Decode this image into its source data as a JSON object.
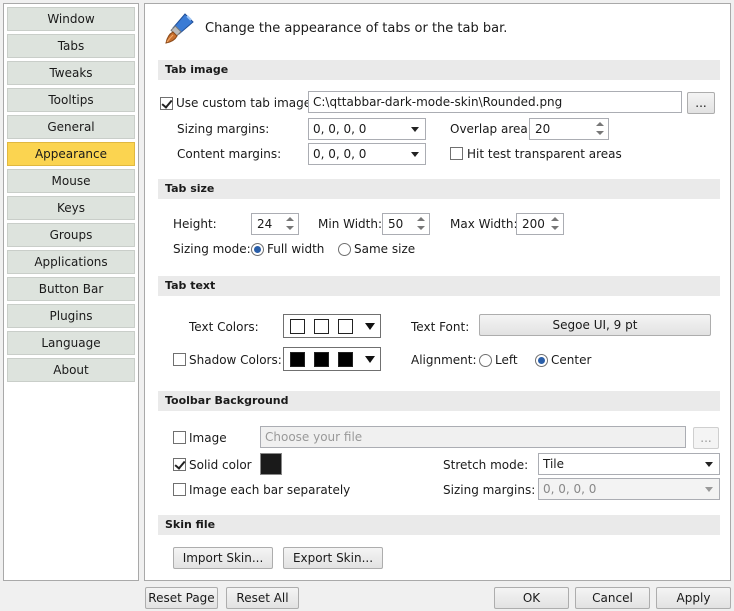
{
  "sidebar": {
    "items": [
      {
        "label": "Window"
      },
      {
        "label": "Tabs"
      },
      {
        "label": "Tweaks"
      },
      {
        "label": "Tooltips"
      },
      {
        "label": "General"
      },
      {
        "label": "Appearance",
        "active": true
      },
      {
        "label": "Mouse"
      },
      {
        "label": "Keys"
      },
      {
        "label": "Groups"
      },
      {
        "label": "Applications"
      },
      {
        "label": "Button Bar"
      },
      {
        "label": "Plugins"
      },
      {
        "label": "Language"
      },
      {
        "label": "About"
      }
    ]
  },
  "header": {
    "icon": "paintbrush-icon",
    "text": "Change the appearance of tabs or the tab bar."
  },
  "tab_image": {
    "section_title": "Tab image",
    "use_custom_label": "Use custom tab image:",
    "use_custom_checked": true,
    "path_value": "C:\\qttabbar-dark-mode-skin\\Rounded.png",
    "browse_label": "...",
    "sizing_margins_label": "Sizing margins:",
    "sizing_margins_value": "0, 0, 0, 0",
    "overlap_label": "Overlap area:",
    "overlap_value": "20",
    "content_margins_label": "Content margins:",
    "content_margins_value": "0, 0, 0, 0",
    "hit_test_label": "Hit test transparent areas",
    "hit_test_checked": false
  },
  "tab_size": {
    "section_title": "Tab size",
    "height_label": "Height:",
    "height_value": "24",
    "min_width_label": "Min Width:",
    "min_width_value": "50",
    "max_width_label": "Max Width:",
    "max_width_value": "200",
    "sizing_mode_label": "Sizing mode:",
    "full_width_label": "Full width",
    "same_size_label": "Same size",
    "selected_mode": "Full width"
  },
  "tab_text": {
    "section_title": "Tab text",
    "text_colors_label": "Text Colors:",
    "text_colors": [
      "#ffffff",
      "#ffffff",
      "#ffffff"
    ],
    "shadow_colors_label": "Shadow Colors:",
    "shadow_checked": false,
    "shadow_colors": [
      "#000000",
      "#000000",
      "#000000"
    ],
    "text_font_label": "Text Font:",
    "text_font_value": "Segoe UI, 9 pt",
    "alignment_label": "Alignment:",
    "left_label": "Left",
    "center_label": "Center",
    "selected_alignment": "Center"
  },
  "toolbar_background": {
    "section_title": "Toolbar Background",
    "image_label": "Image",
    "image_checked": false,
    "file_placeholder": "Choose your file",
    "browse_label": "...",
    "solid_color_label": "Solid color",
    "solid_color_checked": true,
    "solid_color_value": "#1a1a1a",
    "stretch_mode_label": "Stretch mode:",
    "stretch_mode_value": "Tile",
    "each_bar_label": "Image each bar separately",
    "each_bar_checked": false,
    "sizing_margins_label": "Sizing margins:",
    "sizing_margins_value": "0, 0, 0, 0"
  },
  "skin_file": {
    "section_title": "Skin file",
    "import_label": "Import Skin...",
    "export_label": "Export Skin..."
  },
  "footer": {
    "reset_page": "Reset Page",
    "reset_all": "Reset All",
    "ok": "OK",
    "cancel": "Cancel",
    "apply": "Apply"
  },
  "colors": {
    "active_nav": "#fbd450",
    "nav_bg": "#dde3dd",
    "section_bg": "#eaeaea"
  }
}
